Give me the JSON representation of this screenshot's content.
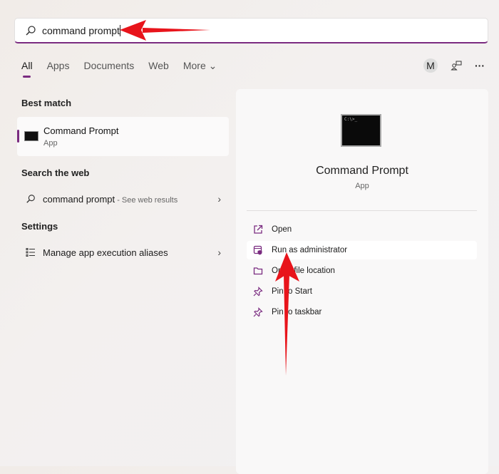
{
  "search": {
    "query": "command prompt",
    "icon": "search-icon"
  },
  "tabs": [
    {
      "label": "All"
    },
    {
      "label": "Apps"
    },
    {
      "label": "Documents"
    },
    {
      "label": "Web"
    },
    {
      "label": "More ⌄"
    }
  ],
  "header": {
    "avatar": "M",
    "more": "···"
  },
  "best_match": {
    "heading": "Best match",
    "title": "Command Prompt",
    "subtitle": "App"
  },
  "web": {
    "heading": "Search the web",
    "query": "command prompt",
    "suffix": " - See web results"
  },
  "settings": {
    "heading": "Settings",
    "item": "Manage app execution aliases"
  },
  "detail": {
    "title": "Command Prompt",
    "subtitle": "App",
    "icon_text": "C:\\>_",
    "actions": [
      {
        "label": "Open"
      },
      {
        "label": "Run as administrator"
      },
      {
        "label": "Open file location"
      },
      {
        "label": "Pin to Start"
      },
      {
        "label": "Pin to taskbar"
      }
    ]
  },
  "colors": {
    "accent": "#7a2b80",
    "arrow": "#e8141b"
  }
}
